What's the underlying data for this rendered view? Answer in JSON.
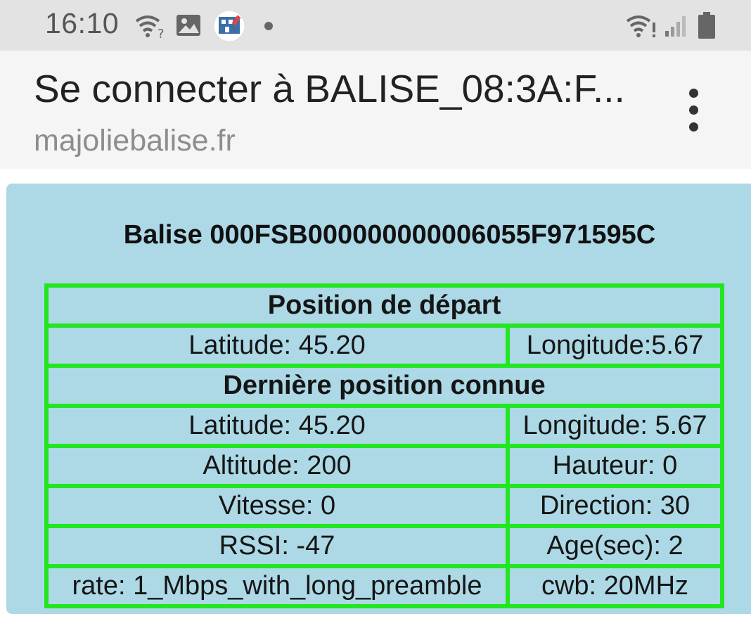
{
  "status_bar": {
    "time": "16:10",
    "icons": [
      "wifi-question-icon",
      "image-icon",
      "app-icon",
      "notification-dot",
      "wifi-alert-icon",
      "signal-icon",
      "battery-icon"
    ]
  },
  "header": {
    "title": "Se connecter à BALISE_08:3A:F...",
    "url": "majoliebalise.fr",
    "menu_icon": "more-vert-icon"
  },
  "page": {
    "title": "Balise 000FSB000000000006055F971595C",
    "start_section": "Position de départ",
    "start_latitude": "Latitude: 45.20",
    "start_longitude": "Longitude:5.67",
    "last_section": "Dernière position connue",
    "rows": [
      [
        "Latitude: 45.20",
        "Longitude: 5.67"
      ],
      [
        "Altitude: 200",
        "Hauteur: 0"
      ],
      [
        "Vitesse: 0",
        "Direction: 30"
      ],
      [
        "RSSI: -47",
        "Age(sec): 2"
      ],
      [
        "rate: 1_Mbps_with_long_preamble",
        "cwb: 20MHz"
      ]
    ]
  },
  "colors": {
    "card_background": "#add8e6",
    "table_border": "#22e622"
  }
}
